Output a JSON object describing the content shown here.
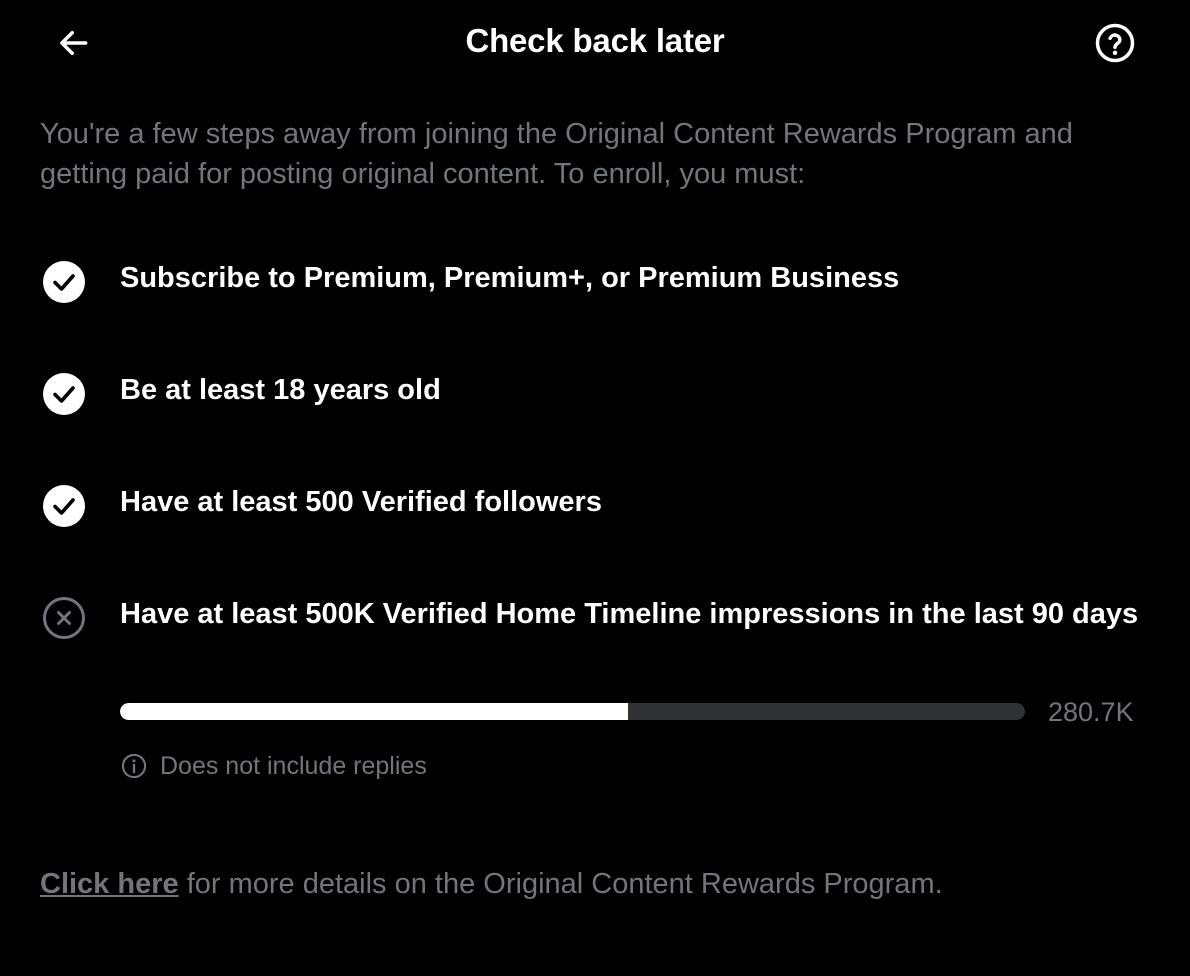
{
  "header": {
    "title": "Check back later",
    "back_icon": "arrow-left-icon",
    "help_icon": "question-circle-icon"
  },
  "intro": "You're a few steps away from joining the Original Content Rewards Program and getting paid for posting original content. To enroll, you must:",
  "requirements": [
    {
      "text": "Subscribe to Premium, Premium+, or Premium Business",
      "status": "complete",
      "icon": "check-circle-icon"
    },
    {
      "text": "Be at least 18 years old",
      "status": "complete",
      "icon": "check-circle-icon"
    },
    {
      "text": "Have at least 500 Verified followers",
      "status": "complete",
      "icon": "check-circle-icon"
    },
    {
      "text": "Have at least 500K Verified Home Timeline impressions in the last 90 days",
      "status": "incomplete",
      "icon": "x-circle-icon"
    }
  ],
  "progress": {
    "current": 280700,
    "target": 500000,
    "fraction": 0.5614,
    "label": "280.7K"
  },
  "note": {
    "icon": "info-icon",
    "text": "Does not include replies"
  },
  "footer": {
    "link_text": "Click here",
    "rest_text": " for more details on the Original Content Rewards Program."
  },
  "colors": {
    "background": "#000000",
    "text_primary": "#ffffff",
    "text_secondary": "#71767b",
    "progress_track": "#2f3336",
    "progress_fill": "#ffffff"
  }
}
